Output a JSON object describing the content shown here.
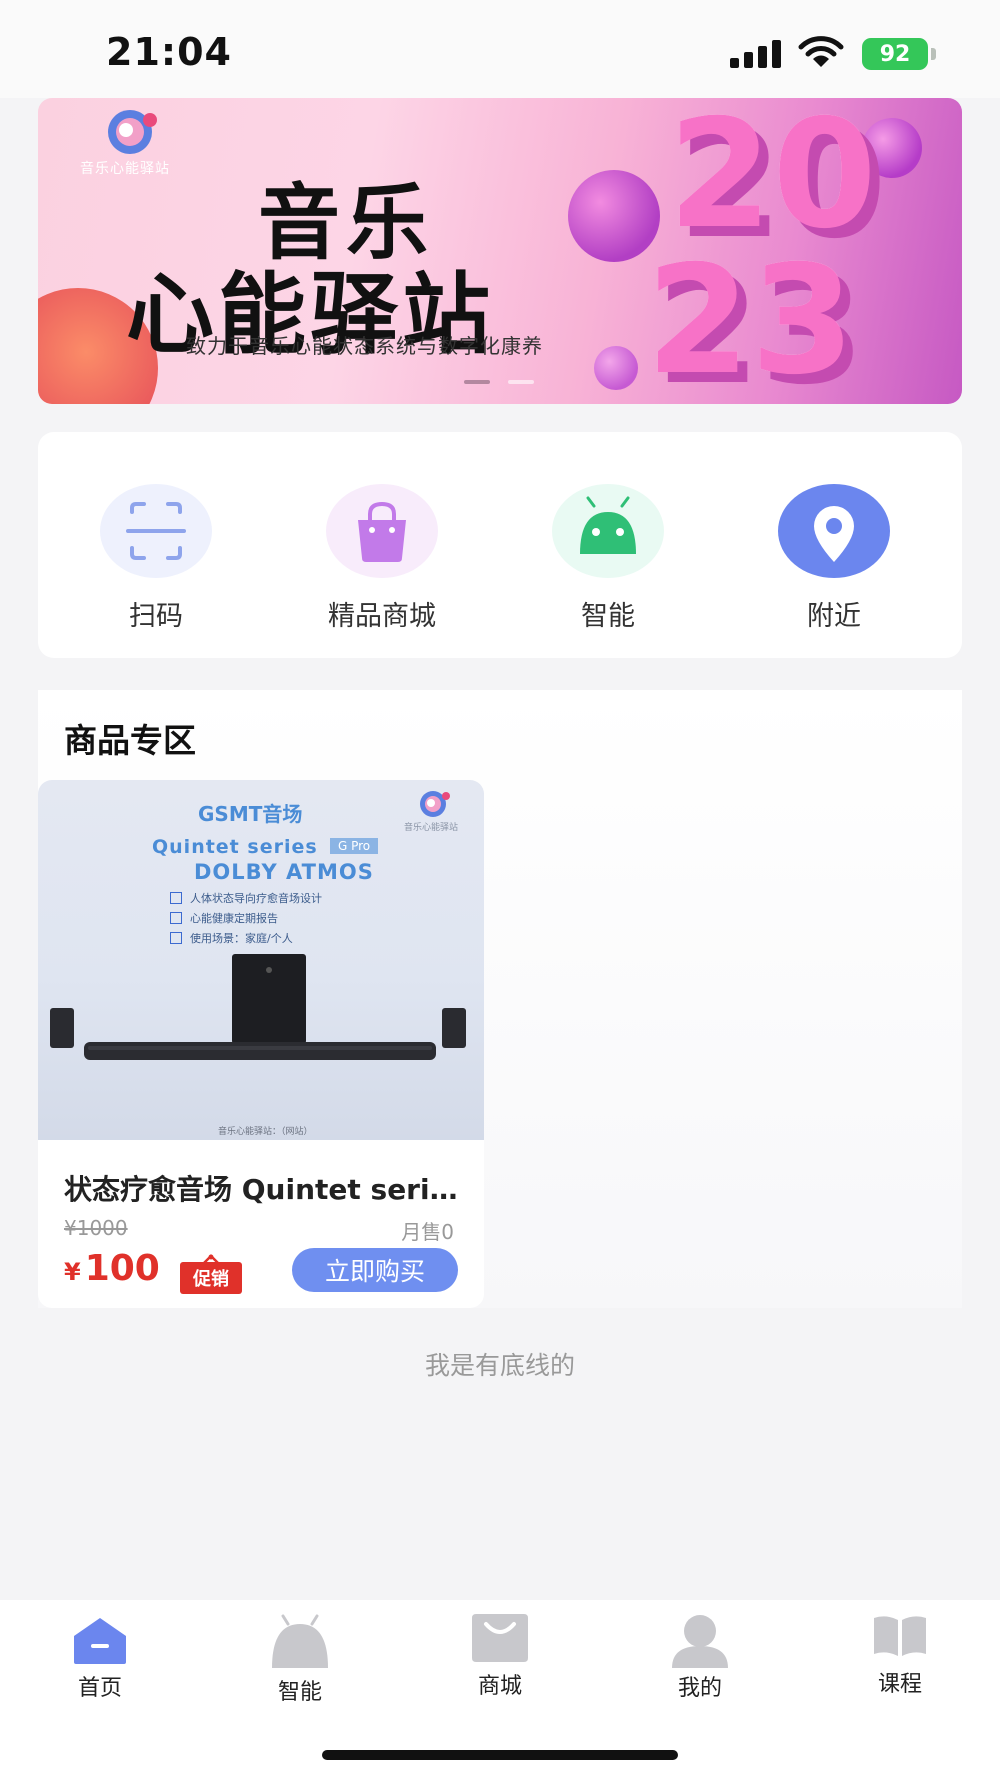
{
  "status_bar": {
    "time": "21:04",
    "battery": "92"
  },
  "banner": {
    "logo_text": "音乐心能驿站",
    "title_line1": "音乐",
    "title_line2": "心能驿站",
    "subtitle": "致力于音乐心能状态系统与数字化康养",
    "year_line1": "20",
    "year_line2": "23",
    "active_dot": 0,
    "dot_count": 2
  },
  "quick_menu": [
    {
      "label": "扫码",
      "icon": "scan-icon",
      "bg": "#eef1fd"
    },
    {
      "label": "精品商城",
      "icon": "shopping-bag-icon",
      "bg": "#f8ecfb"
    },
    {
      "label": "智能",
      "icon": "android-robot-icon",
      "bg": "#e9faf3"
    },
    {
      "label": "附近",
      "icon": "location-pin-icon",
      "bg": "#6b86ee"
    }
  ],
  "products_section": {
    "title": "商品专区",
    "products": [
      {
        "image": {
          "brand": "GSMT音场",
          "series": "Quintet series",
          "badge": "G Pro",
          "dolby": "DOLBY ATMOS",
          "features": [
            "人体状态导向疗愈音场设计",
            "心能健康定期报告",
            "使用场景：家庭/个人"
          ],
          "logo_text": "音乐心能驿站",
          "footer": "音乐心能驿站：（网站）"
        },
        "name": "状态疗愈音场 Quintet series G Pro",
        "original_price": "¥1000",
        "sold": "月售0",
        "currency": "¥",
        "price": "100",
        "promo_label": "促销",
        "buy_label": "立即购买"
      }
    ]
  },
  "end_text": "我是有底线的",
  "tab_bar": {
    "active": "home",
    "accent": "#6b86ee",
    "inactive_color": "#c8c8cc",
    "items": [
      {
        "label": "首页",
        "icon": "home-icon"
      },
      {
        "label": "智能",
        "icon": "android-robot-icon"
      },
      {
        "label": "商城",
        "icon": "shopping-bag-icon"
      },
      {
        "label": "我的",
        "icon": "user-icon"
      },
      {
        "label": "课程",
        "icon": "book-icon"
      }
    ]
  }
}
